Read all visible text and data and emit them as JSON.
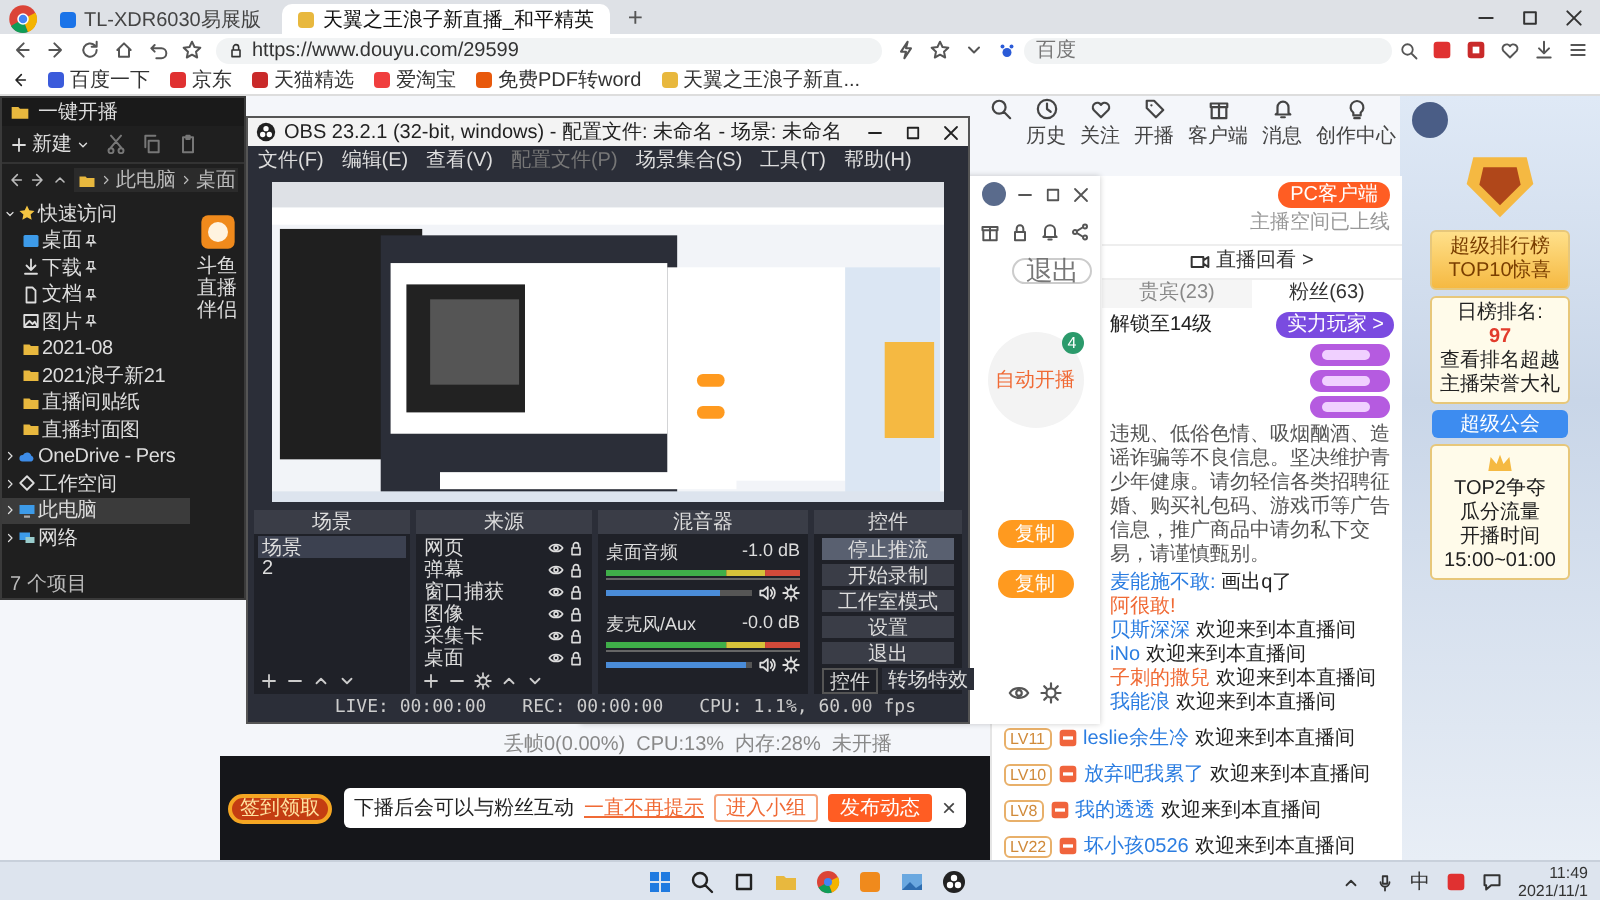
{
  "browser": {
    "tabs": [
      {
        "label": "TL-XDR6030易展版",
        "selected": false
      },
      {
        "label": "天翼之王浪子新直播_和平精英",
        "selected": true
      }
    ],
    "new_tab": "+",
    "address": "https://www.douyu.com/29599",
    "search_placeholder": "百度",
    "bookmarks": [
      "百度一下",
      "京东",
      "天猫精选",
      "爱淘宝",
      "免费PDF转word",
      "天翼之王浪子新直..."
    ]
  },
  "site": {
    "nav": [
      "历史",
      "关注",
      "开播",
      "客户端",
      "消息",
      "创作中心"
    ],
    "chat": {
      "pc_client": "PC客户端",
      "space_notice": "主播空间已上线",
      "replay": "直播回看 >",
      "tabs": [
        {
          "label": "贵宾(23)",
          "selected": false
        },
        {
          "label": "粉丝(63)",
          "selected": true
        }
      ],
      "rank_text": "解锁至14级",
      "rank_badge": "实力玩家 >",
      "notice": "违规、低俗色情、吸烟酗酒、造谣诈骗等不良信息。坚决维护青少年健康。请勿轻信各类招聘征婚、购买礼包码、游戏币等广告信息，推广商品中请勿私下交易，请谨慎甄别。",
      "messages": [
        {
          "user": "麦能施不敢:",
          "text": "画出q了",
          "color": "#2b7de1"
        },
        {
          "user": "阿很敢!",
          "color": "#f06a35"
        },
        {
          "user": "贝斯深深",
          "text": "欢迎来到本直播间",
          "color": "#2b7de1"
        },
        {
          "user": "iNo",
          "text": "欢迎来到本直播间",
          "color": "#2b7de1"
        },
        {
          "user": "子刺的撒兒",
          "text": "欢迎来到本直播间",
          "color": "#f06a35"
        },
        {
          "user": "我能浪",
          "text": "欢迎来到本直播间",
          "color": "#2b7de1"
        }
      ],
      "fan_messages": [
        {
          "rank": "LV11",
          "user": "leslie余生冷",
          "text": "欢迎来到本直播间"
        },
        {
          "rank": "LV10",
          "user": "放弃吧我累了",
          "text": "欢迎来到本直播间"
        },
        {
          "rank": "LV8",
          "user": "我的透透",
          "text": "欢迎来到本直播间"
        },
        {
          "rank": "LV22",
          "user": "坏小孩0526",
          "text": "欢迎来到本直播间"
        }
      ]
    },
    "banner": {
      "rank_title": "超级排行榜",
      "rank_subtitle": "TOP10惊喜",
      "rank_label": "日榜排名:",
      "rank_value": "97",
      "rank_hint": [
        "查看排名超越",
        "主播荣誉大礼"
      ],
      "guild_button": "超级公会",
      "guild_title": "TOP2争夺",
      "guild_subtitle": "瓜分流量",
      "schedule_label": "开播时间",
      "schedule_time": "15:00~01:00"
    },
    "player": {
      "sign_in": "签到领取",
      "toast": {
        "message": "下播后会可以与粉丝互动",
        "dismiss": "一直不再提示",
        "buttons": [
          {
            "label": "进入小组",
            "kind": "secondary"
          },
          {
            "label": "发布动态",
            "kind": "primary"
          }
        ],
        "close": "×"
      }
    }
  },
  "assistant": {
    "exit": "退出",
    "step": {
      "badge": "4",
      "label": "自动开播"
    },
    "copy_buttons": [
      "复制",
      "复制"
    ],
    "stats": "丢帧0(0.00%)  CPU:13%  内存:28%  未开播"
  },
  "explorer": {
    "title": "一键开播",
    "new_button": "新建",
    "path": [
      "此电脑",
      "桌面"
    ],
    "nav": [
      {
        "label": "快速访问",
        "kind": "header",
        "pinned": false,
        "selected": false
      },
      {
        "label": "桌面",
        "kind": "desktop",
        "pinned": true,
        "selected": false
      },
      {
        "label": "下载",
        "kind": "download",
        "pinned": true,
        "selected": false
      },
      {
        "label": "文档",
        "kind": "document",
        "pinned": true,
        "selected": false
      },
      {
        "label": "图片",
        "kind": "picture",
        "pinned": true,
        "selected": false
      },
      {
        "label": "2021-08",
        "kind": "folder",
        "pinned": false,
        "selected": false
      },
      {
        "label": "2021浪子新21",
        "kind": "folder",
        "pinned": false,
        "selected": false
      },
      {
        "label": "直播间贴纸",
        "kind": "folder",
        "pinned": false,
        "selected": false
      },
      {
        "label": "直播封面图",
        "kind": "folder",
        "pinned": false,
        "selected": false
      },
      {
        "label": "OneDrive - Pers",
        "kind": "cloud",
        "pinned": false,
        "selected": false
      },
      {
        "label": "工作空间",
        "kind": "workspace",
        "pinned": false,
        "selected": false
      },
      {
        "label": "此电脑",
        "kind": "pc",
        "pinned": false,
        "selected": true
      },
      {
        "label": "网络",
        "kind": "network",
        "pinned": false,
        "selected": false
      }
    ],
    "files": [
      "斗鱼直播伴侣"
    ],
    "status": "7 个项目"
  },
  "obs": {
    "title": "OBS 23.2.1 (32-bit, windows) - 配置文件: 未命名 - 场景: 未命名",
    "menu": [
      {
        "label": "文件(F)",
        "disabled": false
      },
      {
        "label": "编辑(E)",
        "disabled": false
      },
      {
        "label": "查看(V)",
        "disabled": false
      },
      {
        "label": "配置文件(P)",
        "disabled": true
      },
      {
        "label": "场景集合(S)",
        "disabled": false
      },
      {
        "label": "工具(T)",
        "disabled": false
      },
      {
        "label": "帮助(H)",
        "disabled": false
      }
    ],
    "scenes": {
      "title": "场景",
      "items": [
        {
          "label": "场景",
          "selected": true
        },
        {
          "label": "2",
          "selected": false
        }
      ]
    },
    "sources": {
      "title": "来源",
      "items": [
        "网页",
        "弹幕",
        "窗口捕获",
        "图像",
        "采集卡",
        "桌面"
      ]
    },
    "mixer": {
      "title": "混音器",
      "channels": [
        {
          "name": "桌面音频",
          "reading": "-1.0 dB",
          "level": 0.78
        },
        {
          "name": "麦克风/Aux",
          "reading": "-0.0 dB",
          "level": 0.96
        }
      ]
    },
    "controls": {
      "title": "控件",
      "buttons": [
        "停止推流",
        "开始录制",
        "工作室模式",
        "设置",
        "退出"
      ],
      "tabs": [
        {
          "label": "控件",
          "selected": true
        },
        {
          "label": "转场特效",
          "selected": false
        }
      ]
    },
    "status": [
      "LIVE: 00:00:00",
      "REC: 00:00:00",
      "CPU: 1.1%, 60.00 fps"
    ]
  },
  "taskbar": {
    "ime": "中",
    "time": "11:49",
    "date": "2021/11/1"
  }
}
